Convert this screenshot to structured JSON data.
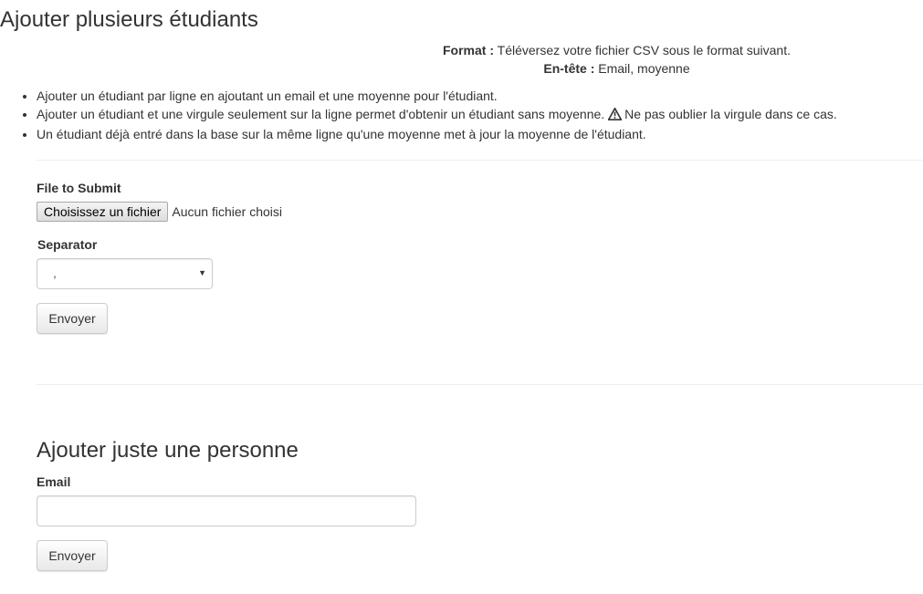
{
  "page": {
    "title": "Ajouter plusieurs étudiants"
  },
  "format": {
    "format_label": "Format :",
    "format_text": "Téléversez votre fichier CSV sous le format suivant.",
    "header_label": "En-tête :",
    "header_text": "Email, moyenne"
  },
  "rules": {
    "items": [
      "Ajouter un étudiant par ligne en ajoutant un email et une moyenne pour l'étudiant.",
      "Ajouter un étudiant et une virgule seulement sur la ligne permet d'obtenir un étudiant sans moyenne.",
      "Un étudiant déjà entré dans la base sur la même ligne qu'une moyenne met à jour la moyenne de l'étudiant."
    ],
    "warning_text": "Ne pas oublier la virgule dans ce cas.",
    "warning_icon": "warning-triangle-icon"
  },
  "upload_form": {
    "file_label": "File to Submit",
    "file_button_label": "Choisissez un fichier",
    "file_status": "Aucun fichier choisi",
    "separator_label": "Separator",
    "separator_value": ",",
    "submit_label": "Envoyer"
  },
  "single_form": {
    "title": "Ajouter juste une personne",
    "email_label": "Email",
    "email_value": "",
    "submit_label": "Envoyer"
  }
}
